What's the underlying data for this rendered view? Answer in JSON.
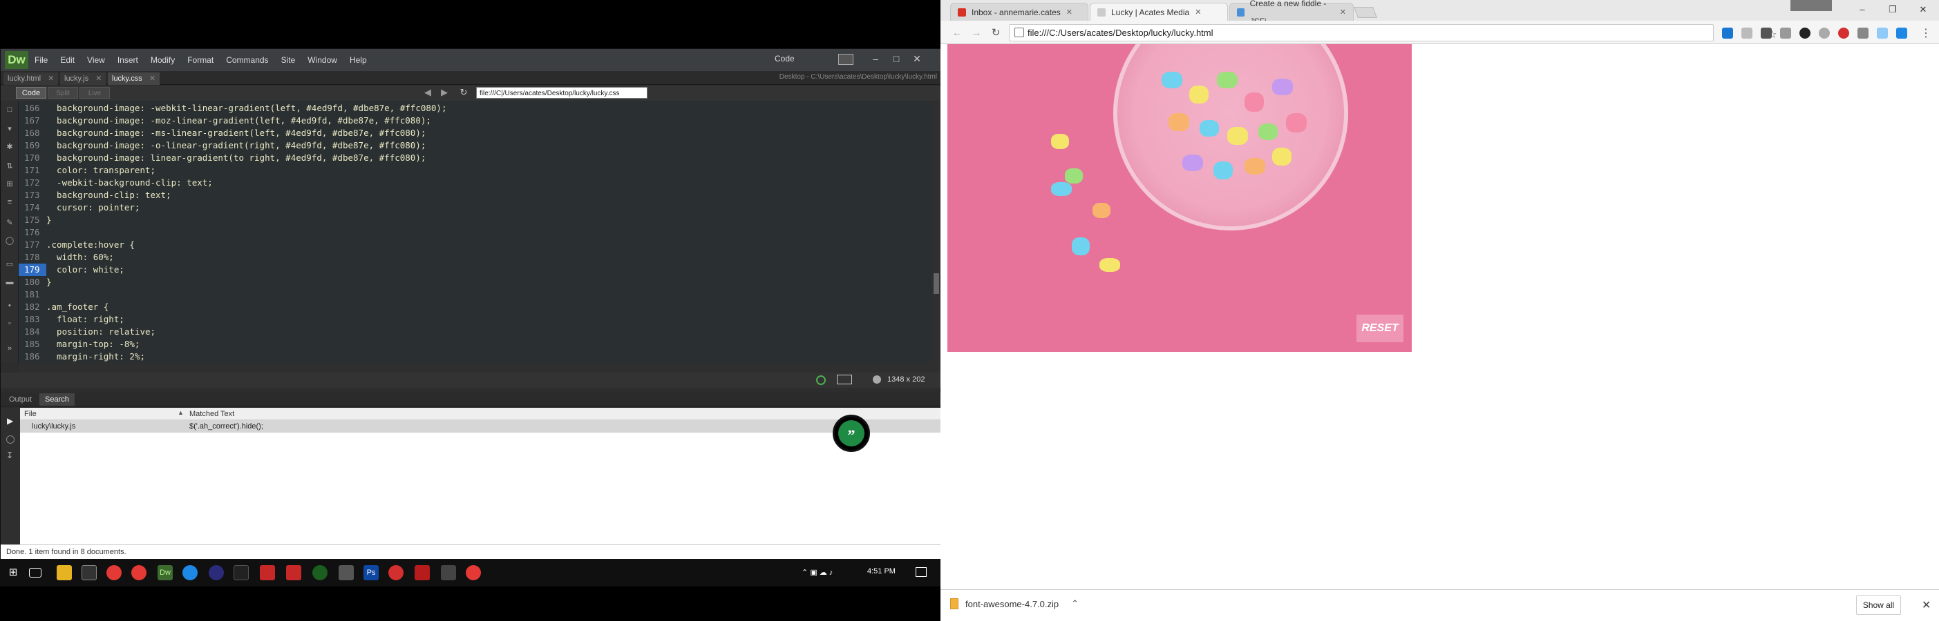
{
  "dreamweaver": {
    "logo": "Dw",
    "menus": [
      "File",
      "Edit",
      "View",
      "Insert",
      "Modify",
      "Format",
      "Commands",
      "Site",
      "Window",
      "Help"
    ],
    "layout_label": "Code",
    "tabs": [
      {
        "label": "lucky.html"
      },
      {
        "label": "lucky.js"
      },
      {
        "label": "lucky.css",
        "active": true
      }
    ],
    "doc_path": "Desktop - C:\\Users\\acates\\Desktop\\lucky\\lucky.html",
    "toolbar": {
      "code": "Code",
      "split": "Split",
      "live": "Live",
      "url": "file:///C|/Users/acates/Desktop/lucky/lucky.css"
    },
    "code_lines": [
      {
        "n": "166",
        "t": "  background-image: -webkit-linear-gradient(left, #4ed9fd, #dbe87e, #ffc080);"
      },
      {
        "n": "167",
        "t": "  background-image: -moz-linear-gradient(left, #4ed9fd, #dbe87e, #ffc080);"
      },
      {
        "n": "168",
        "t": "  background-image: -ms-linear-gradient(left, #4ed9fd, #dbe87e, #ffc080);"
      },
      {
        "n": "169",
        "t": "  background-image: -o-linear-gradient(right, #4ed9fd, #dbe87e, #ffc080);"
      },
      {
        "n": "170",
        "t": "  background-image: linear-gradient(to right, #4ed9fd, #dbe87e, #ffc080);"
      },
      {
        "n": "171",
        "t": "  color: transparent;"
      },
      {
        "n": "172",
        "t": "  -webkit-background-clip: text;"
      },
      {
        "n": "173",
        "t": "  background-clip: text;"
      },
      {
        "n": "174",
        "t": "  cursor: pointer;"
      },
      {
        "n": "175",
        "t": "}"
      },
      {
        "n": "176",
        "t": ""
      },
      {
        "n": "177",
        "t": ".complete:hover {"
      },
      {
        "n": "178",
        "t": "  width: 60%;"
      },
      {
        "n": "179",
        "t": "  color: white;",
        "current": true
      },
      {
        "n": "180",
        "t": "}"
      },
      {
        "n": "181",
        "t": ""
      },
      {
        "n": "182",
        "t": ".am_footer {"
      },
      {
        "n": "183",
        "t": "  float: right;"
      },
      {
        "n": "184",
        "t": "  position: relative;"
      },
      {
        "n": "185",
        "t": "  margin-top: -8%;"
      },
      {
        "n": "186",
        "t": "  margin-right: 2%;"
      }
    ],
    "status_dims": "1348 x 202",
    "panel_tabs": [
      "Output",
      "Search"
    ],
    "results": {
      "col_file": "File",
      "col_match": "Matched Text",
      "row_file": "lucky\\lucky.js",
      "row_match": "$('.ah_correct').hide();"
    },
    "bottom_status": "Done. 1 item found in 8 documents."
  },
  "taskbar": {
    "clock": "4:51 PM"
  },
  "chrome": {
    "tabs": [
      {
        "label": "Inbox - annemarie.cates",
        "icon_color": "#d93025"
      },
      {
        "label": "Lucky | Acates Media",
        "icon_color": "#888888",
        "active": true
      },
      {
        "label": "Create a new fiddle - JSFi",
        "icon_color": "#4a90d9"
      }
    ],
    "url": "file:///C:/Users/acates/Desktop/lucky/lucky.html",
    "reset_label": "RESET",
    "download": {
      "file": "font-awesome-4.7.0.zip",
      "show_all": "Show all"
    }
  },
  "colors": {
    "code_bg": "#2a2f31",
    "hero_pink": "#e8739a",
    "current_line": "#2e6cc2"
  }
}
